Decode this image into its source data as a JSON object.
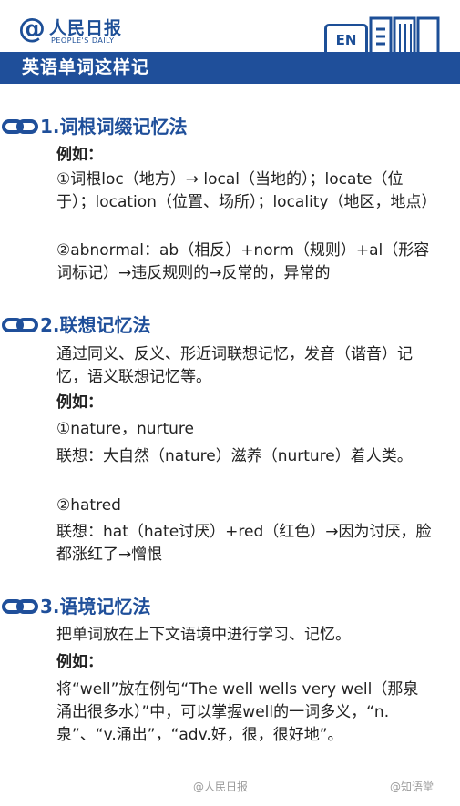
{
  "header": {
    "logo_at": "@",
    "logo_name": "人民日报",
    "logo_subtitle": "PEOPLE'S DAILY",
    "badge": "EN",
    "title": "英语单词这样记"
  },
  "sections": [
    {
      "heading": "1.词根词缀记忆法",
      "example_label": "例如：",
      "items": [
        "①词根loc（地方）→  local（当地的）；locate（位于）；location（位置、场所）；locality（地区，地点）",
        "②abnormal：ab（相反）+norm（规则）+al（形容词标记）→违反规则的→反常的，异常的"
      ]
    },
    {
      "heading": "2.联想记忆法",
      "intro": "通过同义、反义、形近词联想记忆，发音（谐音）记忆，语义联想记忆等。",
      "example_label": "例如：",
      "items": [
        "①nature，nurture",
        "联想：大自然（nature）滋养（nurture）着人类。",
        "②hatred",
        "联想：hat（hate讨厌）+red（红色）→因为讨厌，脸都涨红了→憎恨"
      ]
    },
    {
      "heading": "3.语境记忆法",
      "intro": "把单词放在上下文语境中进行学习、记忆。",
      "example_label": "例如：",
      "items": [
        "将“well”放在例句“The well wells very well（那泉涌出很多水）”中，可以掌握well的一词多义，“n.泉”、“v.涌出”，“adv.好，很，很好地”。"
      ]
    }
  ],
  "watermarks": {
    "left": "@人民日报",
    "right": "@知语堂"
  },
  "colors": {
    "brand_blue": "#1f4f9a"
  }
}
